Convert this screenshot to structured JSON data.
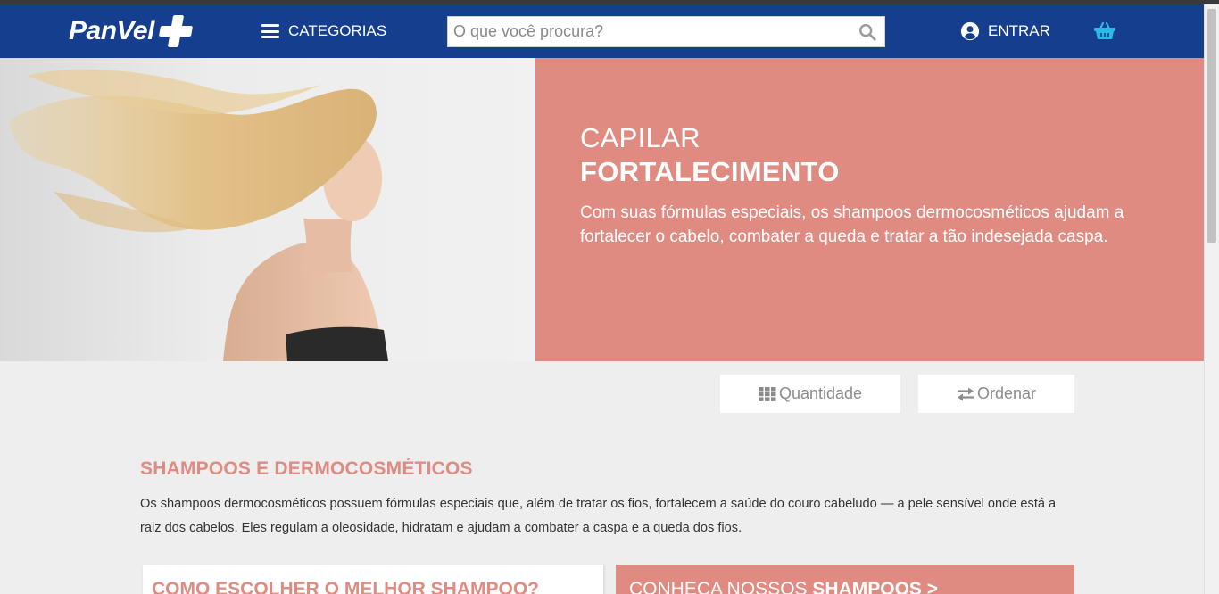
{
  "header": {
    "logo_text": "PanVel",
    "categories_label": "CATEGORIAS",
    "search_placeholder": "O que você procura?",
    "login_label": "ENTRAR",
    "background_color": "#153e8e"
  },
  "hero": {
    "kicker": "CAPILAR",
    "title": "FORTALECIMENTO",
    "description": "Com suas fórmulas especiais, os shampoos dermocosméticos ajudam a fortalecer o cabelo, combater a queda e tratar a tão indesejada caspa.",
    "accent_color": "#df8b82"
  },
  "controls": {
    "quantity_label": "Quantidade",
    "sort_label": "Ordenar"
  },
  "section": {
    "title": "SHAMPOOS E DERMOCOSMÉTICOS",
    "text": "Os shampoos dermocosméticos possuem fórmulas especiais que, além de tratar os fios, fortalecem a saúde do couro cabeludo — a pele sensível onde está a raiz dos cabelos. Eles regulam a oleosidade, hidratam e ajudam a combater a caspa e a queda dos fios."
  },
  "cards": {
    "left_label": "COMO ESCOLHER O MELHOR SHAMPOO?",
    "right_prefix": "CONHEÇA NOSSOS",
    "right_strong": "SHAMPOOS >"
  },
  "icons": [
    "bars-icon",
    "search-icon",
    "user-circle-icon",
    "shopping-basket-icon",
    "th-grid-icon",
    "exchange-arrows-icon"
  ]
}
